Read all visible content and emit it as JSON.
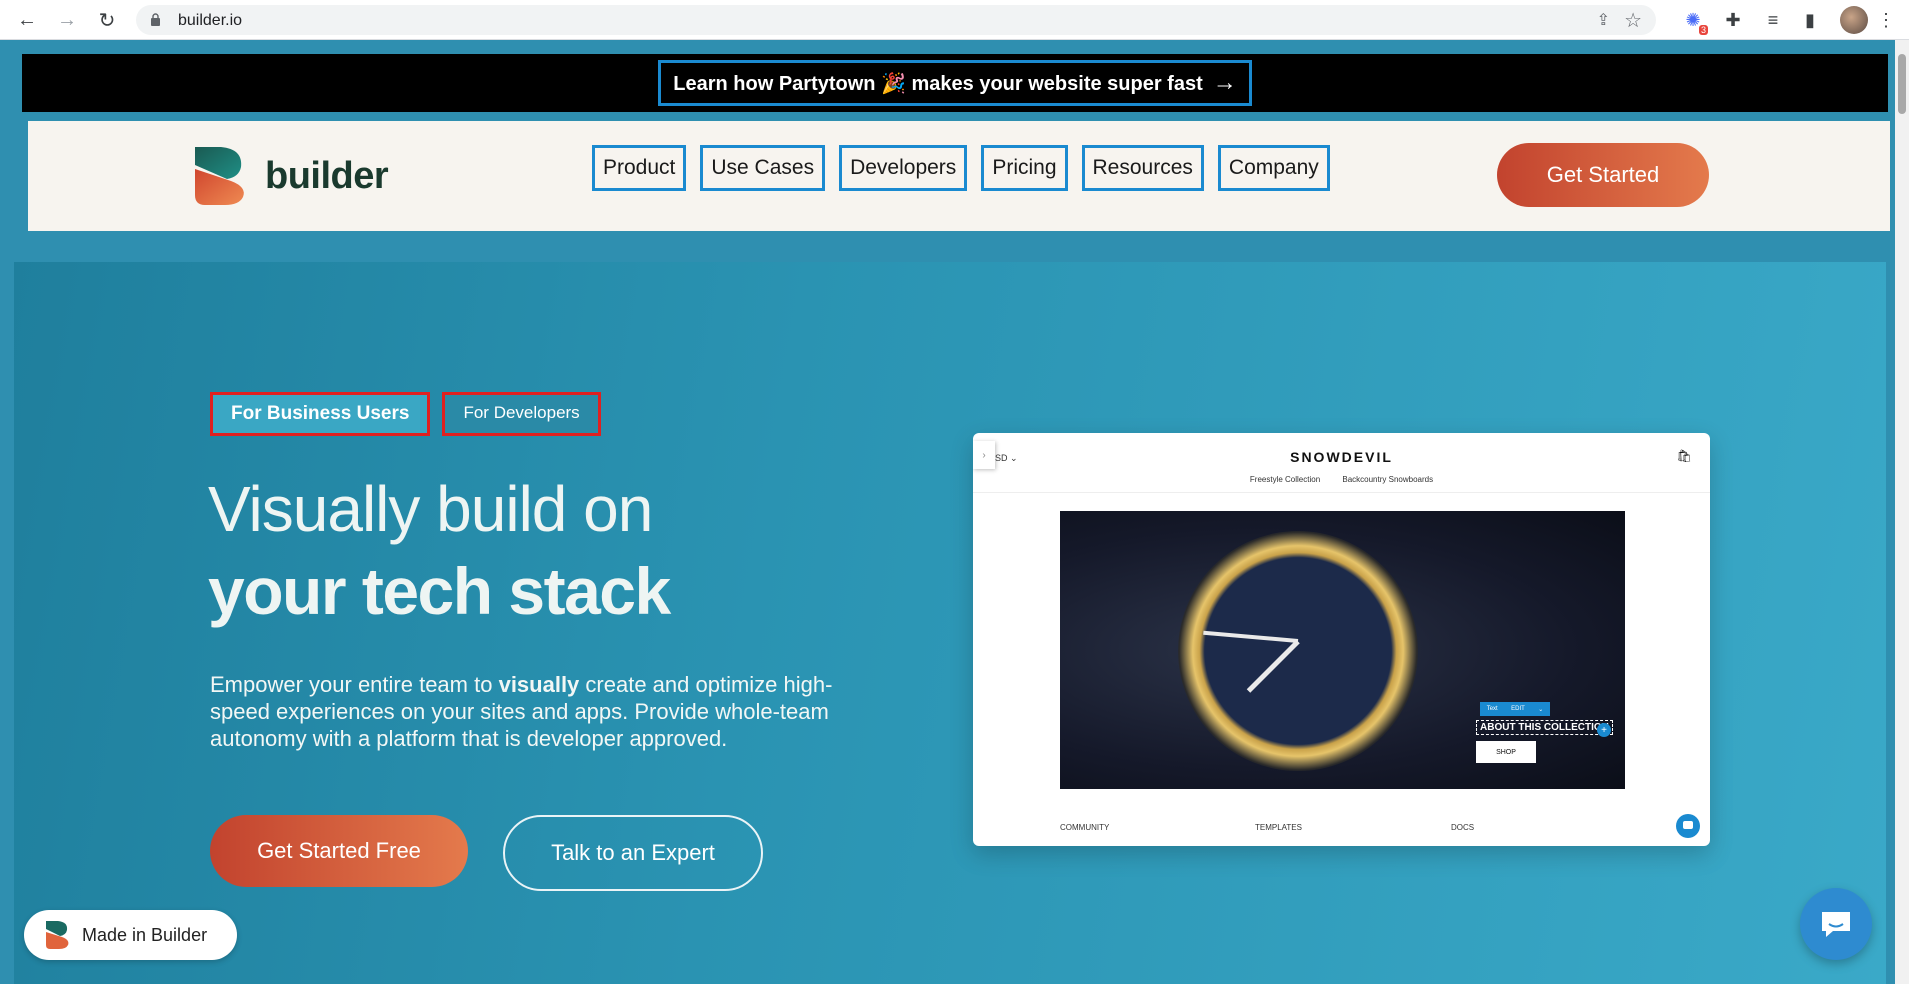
{
  "browser": {
    "url": "builder.io",
    "extension_badge": "3"
  },
  "announcement": {
    "text": "Learn how Partytown 🎉  makes your website super fast",
    "arrow": "→"
  },
  "header": {
    "logo_text": "builder",
    "nav": [
      "Product",
      "Use Cases",
      "Developers",
      "Pricing",
      "Resources",
      "Company"
    ],
    "cta": "Get Started"
  },
  "hero": {
    "tabs": [
      "For Business Users",
      "For Developers"
    ],
    "headline_line1": "Visually build on",
    "headline_line2": "your tech stack",
    "subcopy_pre": "Empower your entire team to ",
    "subcopy_bold": "visually",
    "subcopy_post": " create and optimize high-speed experiences on your sites and apps. Provide whole-team autonomy with a platform that is developer approved.",
    "primary_button": "Get Started Free",
    "secondary_button": "Talk to an Expert"
  },
  "preview": {
    "currency": "SD",
    "brand": "SNOWDEVIL",
    "menu": [
      "Freestyle Collection",
      "Backcountry Snowboards"
    ],
    "toolbar": [
      "Text",
      "EDIT"
    ],
    "overlay_title": "ABOUT THIS COLLECTION",
    "shop": "SHOP",
    "footer": [
      "COMMUNITY",
      "TEMPLATES",
      "DOCS"
    ]
  },
  "badge": {
    "text": "Made in Builder"
  },
  "colors": {
    "accent_blue": "#1a8ad0",
    "cta_start": "#c2432e",
    "cta_end": "#e47a4c",
    "hero_bg": "#2a93b2"
  }
}
